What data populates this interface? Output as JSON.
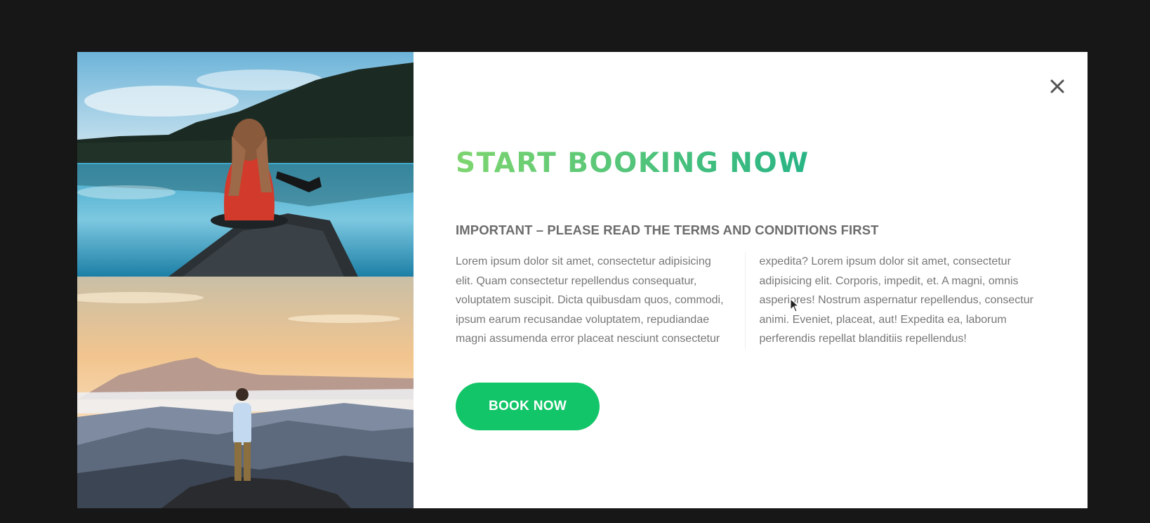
{
  "popup": {
    "close_label": "×",
    "heading": "START BOOKING NOW",
    "subheading": "IMPORTANT – PLEASE READ THE TERMS AND CONDITIONS FIRST",
    "body": "Lorem ipsum dolor sit amet, consectetur adipisicing elit. Quam consectetur repellendus consequatur, voluptatem suscipit. Dicta quibusdam quos, commodi, ipsum earum recusandae voluptatem, repudiandae magni assumenda error placeat nesciunt consectetur expedita? Lorem ipsum dolor sit amet, consectetur adipisicing elit. Corporis, impedit, et. A magni, omnis asperiores! Nostrum aspernatur repellendus, consectur animi. Eveniet, placeat, aut! Expedita ea, laborum perferendis repellat blanditiis repellendus!",
    "button_label": "BOOK NOW"
  },
  "colors": {
    "background": "#171717",
    "heading_gradient_start": "#7ed56f",
    "heading_gradient_end": "#28b485",
    "button": "#12c568"
  },
  "images": [
    {
      "name": "canoe-lake-photo"
    },
    {
      "name": "mountain-sunrise-photo"
    }
  ],
  "icons": {
    "close": "close-icon",
    "cursor": "mouse-cursor-icon"
  }
}
